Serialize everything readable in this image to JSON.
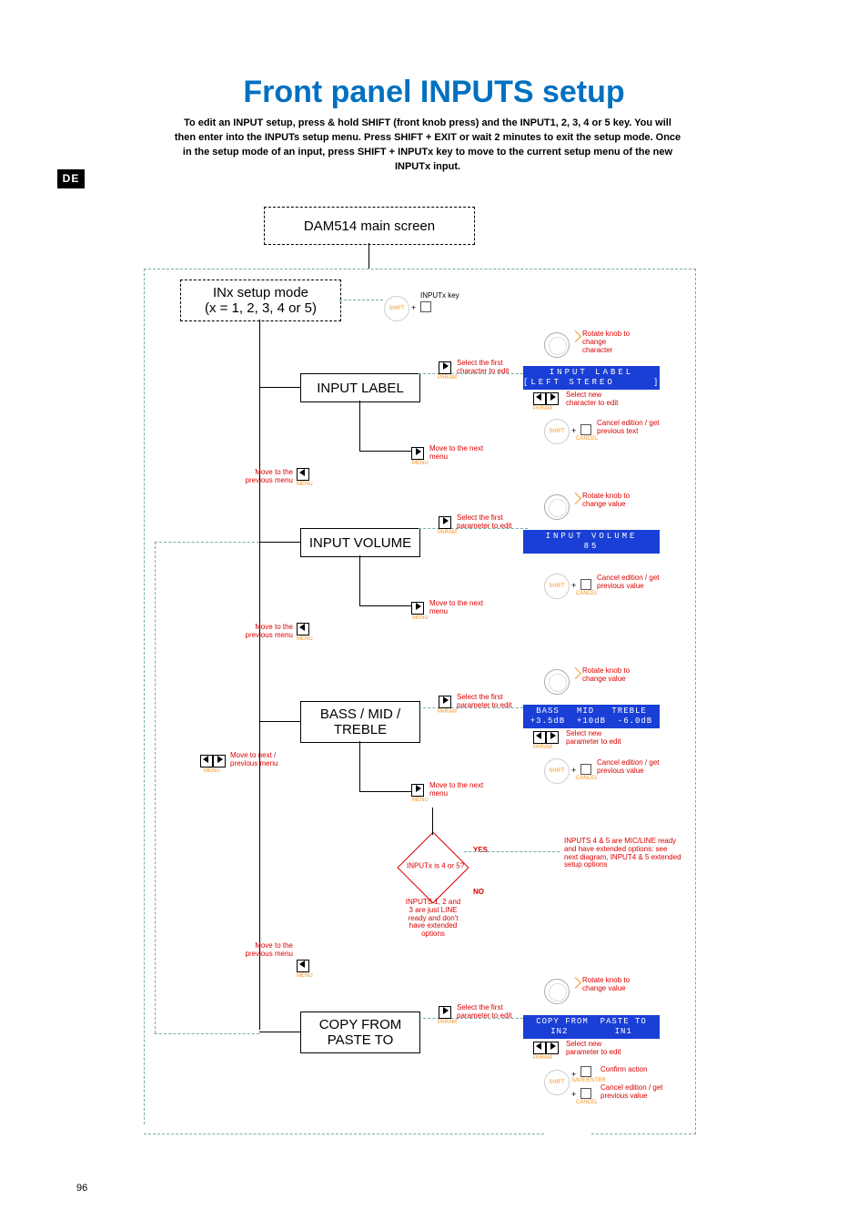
{
  "page_number": "96",
  "lang_tab": "DE",
  "title": "Front panel INPUTS setup",
  "intro": "To edit an INPUT setup, press & hold SHIFT (front knob press) and the INPUT1, 2, 3, 4 or 5 key. You will then enter into the INPUTs setup menu. Press SHIFT + EXIT or wait 2 minutes to exit the setup mode. Once in the setup mode of an input, press SHIFT + INPUTx key to move to the current setup menu of the new INPUTx input.",
  "boxes": {
    "main_screen": "DAM514 main screen",
    "setup_mode_l1": "INx setup mode",
    "setup_mode_l2": "(x = 1, 2, 3, 4 or 5)",
    "input_label": "INPUT LABEL",
    "input_volume": "INPUT VOLUME",
    "eq": "BASS / MID / TREBLE",
    "copy": "COPY FROM PASTE TO"
  },
  "inputx_key": "INPUTx key",
  "select_first_char": "Select the first character to edit",
  "select_first_param": "Select the first parameter to edit",
  "select_new_char": "Select new character to edit",
  "select_new_param": "Select new parameter to edit",
  "rotate_char": "Rotate knob to change character",
  "rotate_val": "Rotate knob to change value",
  "cancel_text": "Cancel edition / get previous text",
  "cancel_val": "Cancel edition / get previous value",
  "next_menu": "Move to the next menu",
  "prev_menu": "Move to the previous menu",
  "nextprev_menu": "Move to next / previous menu",
  "confirm": "Confirm action",
  "shift_lbl": "SHIFT",
  "param_lbl": "PARAM",
  "menu_lbl": "MENU",
  "cancel_lbl": "CANCEL",
  "save_lbl": "SAVE/ENTER",
  "decision": {
    "question": "INPUTx is 4 or 5?",
    "yes": "YES",
    "no": "NO",
    "yes_text": "INPUTS 4 & 5 are MIC/LINE ready and have extended options: see next diagram, INPUT4 & 5 extended setup options",
    "no_l1": "INPUTS 1, 2 and",
    "no_l2": "3 are just LINE",
    "no_l3": "ready and don't",
    "no_l4": "have extended",
    "no_l5": "options"
  },
  "lcd": {
    "label": {
      "r1": "INPUT LABEL",
      "r2": "[LEFT STEREO     ]"
    },
    "volume": {
      "r1": "INPUT VOLUME",
      "r2": "85"
    },
    "eq": {
      "r1": "BASS   MID   TREBLE",
      "r2": "+3.5dB  +10dB  -6.0dB"
    },
    "copy": {
      "r1": "COPY FROM  PASTE TO",
      "r2": "IN2        IN1"
    }
  }
}
